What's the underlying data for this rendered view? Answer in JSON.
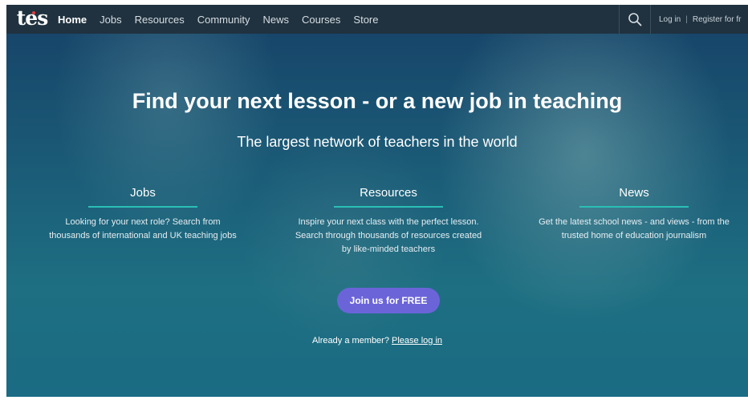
{
  "nav": {
    "logo_text": "tes",
    "links": [
      "Home",
      "Jobs",
      "Resources",
      "Community",
      "News",
      "Courses",
      "Store"
    ],
    "active": "Home",
    "search_icon": "search-icon",
    "login_label": "Log in",
    "separator": "|",
    "register_label": "Register for fr"
  },
  "hero": {
    "title": "Find your next lesson - or a new job in teaching",
    "subtitle": "The largest network of teachers in the world",
    "features": [
      {
        "title": "Jobs",
        "lines": [
          "Looking for your next role? Search from",
          "thousands of international and UK teaching jobs"
        ]
      },
      {
        "title": "Resources",
        "lines": [
          "Inspire your next class with the perfect lesson.",
          "Search through thousands of resources created",
          "by like-minded teachers"
        ]
      },
      {
        "title": "News",
        "lines": [
          "Get the latest school news - and views - from the",
          "trusted home of education journalism"
        ]
      }
    ],
    "cta_label": "Join us for FREE",
    "member_text": "Already a member?",
    "login_link": "Please log in"
  },
  "colors": {
    "navbar": "#20323f",
    "accent_underline": "#2bbfb5",
    "cta": "#6b64d9"
  }
}
